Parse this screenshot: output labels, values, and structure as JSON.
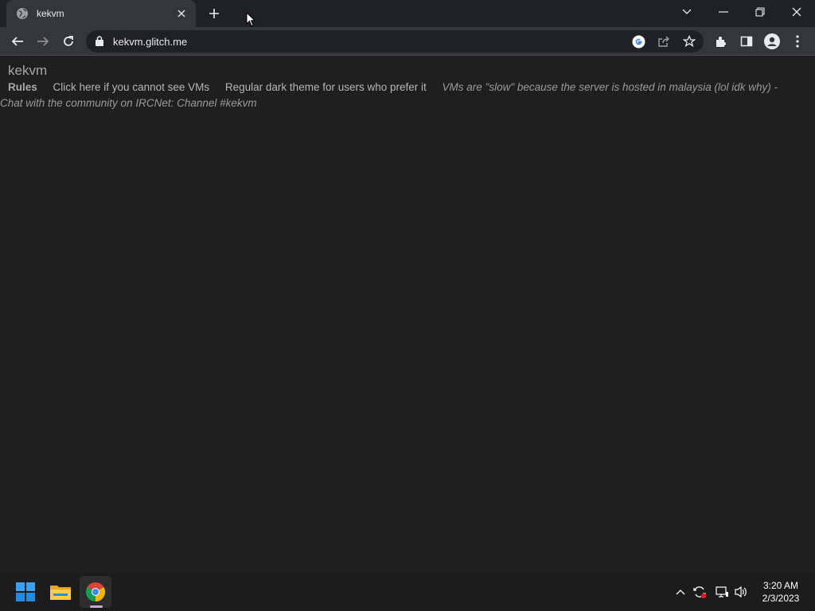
{
  "browser": {
    "tab": {
      "title": "kekvm",
      "favicon": "globe-icon"
    },
    "omnibox": {
      "url": "kekvm.glitch.me"
    },
    "icons": [
      "back-icon",
      "forward-icon",
      "reload-icon",
      "lock-icon",
      "google-icon",
      "share-icon",
      "star-icon",
      "extensions-icon",
      "sidepanel-icon",
      "profile-icon",
      "menu-icon"
    ]
  },
  "page": {
    "site_title": "kekvm",
    "nav": {
      "rules": "Rules",
      "link_vms": "Click here if you cannot see VMs",
      "link_dark": "Regular dark theme for users who prefer it",
      "note": "VMs are \"slow\" because the server is hosted in malaysia (lol idk why) - Chat with the community on IRCNet: Channel #kekvm"
    }
  },
  "taskbar": {
    "time": "3:20 AM",
    "date": "2/3/2023",
    "apps": [
      "windows-start-icon",
      "file-explorer-icon",
      "chrome-icon"
    ]
  },
  "colors": {
    "background": "#1f1f1f",
    "tabstrip": "#202124",
    "toolbar": "#35363a"
  }
}
